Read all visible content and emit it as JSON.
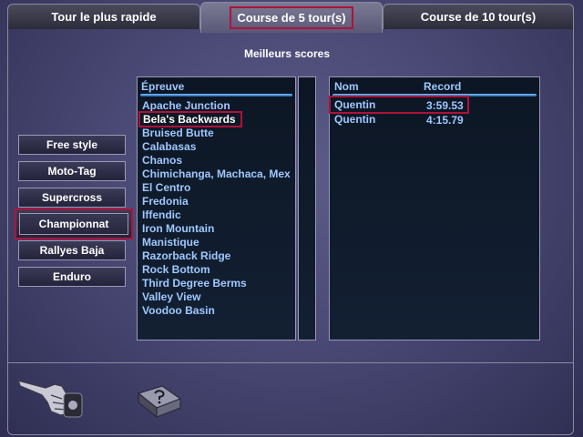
{
  "tabs": [
    {
      "label": "Tour le plus rapide"
    },
    {
      "label": "Course de 5 tour(s)"
    },
    {
      "label": "Course de 10 tour(s)"
    }
  ],
  "section_title": "Meilleurs scores",
  "modes": [
    "Free style",
    "Moto-Tag",
    "Supercross",
    "Championnat",
    "Rallyes Baja",
    "Enduro"
  ],
  "events": {
    "header": "Épreuve",
    "items": [
      "Apache Junction",
      "Bela's Backwards",
      "Bruised Butte",
      "Calabasas",
      "Chanos",
      "Chimichanga, Machaca, Mex",
      "El Centro",
      "Fredonia",
      "Iffendic",
      "Iron Mountain",
      "Manistique",
      "Razorback Ridge",
      "Rock Bottom",
      "Third Degree Berms",
      "Valley View",
      "Voodoo Basin"
    ]
  },
  "scores": {
    "header_name": "Nom",
    "header_record": "Record",
    "rows": [
      {
        "name": "Quentin",
        "record": "3:59.53"
      },
      {
        "name": "Quentin",
        "record": "4:15.79"
      }
    ]
  },
  "colors": {
    "accent": "#b0123a",
    "list_text": "#9fc8ff",
    "panel_bg": "#0c1624"
  },
  "icons": {
    "back": "pointing-hand-icon",
    "help": "help-book-icon"
  }
}
